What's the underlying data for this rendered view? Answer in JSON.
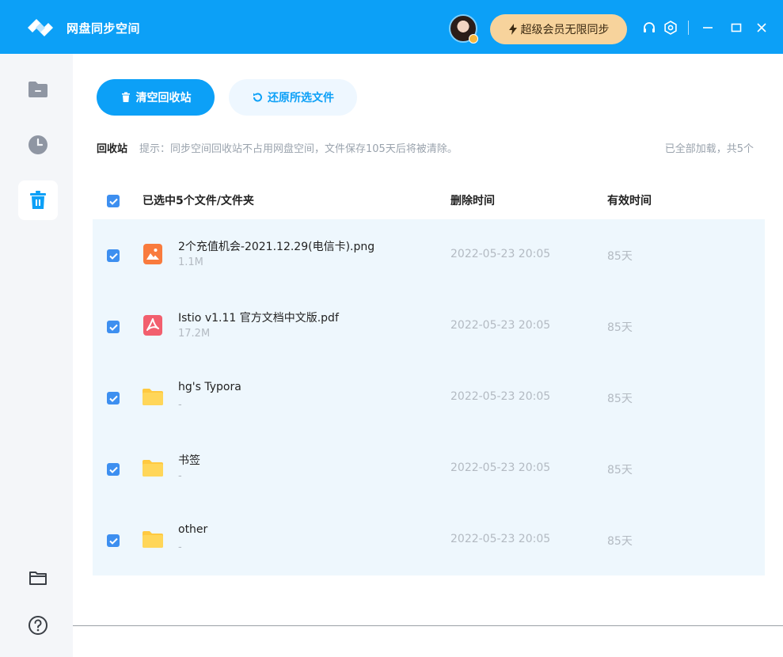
{
  "app": {
    "title": "网盘同步空间"
  },
  "header": {
    "vip_label": "超级会员无限同步",
    "icons": [
      "logo-icon",
      "headset-icon",
      "settings-icon",
      "minimize-icon",
      "maximize-icon",
      "close-icon"
    ]
  },
  "sidebar": {
    "items": [
      "folder-icon",
      "clock-icon",
      "trash-icon"
    ],
    "active": "trash-icon",
    "bottom": [
      "open-folder-icon",
      "help-icon"
    ]
  },
  "toolbar": {
    "empty_label": "清空回收站",
    "restore_label": "还原所选文件"
  },
  "info": {
    "crumb": "回收站",
    "tip": "提示：同步空间回收站不占用网盘空间，文件保存105天后将被清除。",
    "loaded": "已全部加载，共5个"
  },
  "table": {
    "headers": {
      "name": "已选中5个文件/文件夹",
      "deleted": "删除时间",
      "valid": "有效时间"
    },
    "rows": [
      {
        "name": "2个充值机会-2021.12.29(电信卡).png",
        "size": "1.1M",
        "deleted": "2022-05-23 20:05",
        "valid": "85天",
        "type": "image"
      },
      {
        "name": "Istio v1.11 官方文档中文版.pdf",
        "size": "17.2M",
        "deleted": "2022-05-23 20:05",
        "valid": "85天",
        "type": "pdf"
      },
      {
        "name": "hg's Typora",
        "size": "-",
        "deleted": "2022-05-23 20:05",
        "valid": "85天",
        "type": "folder"
      },
      {
        "name": "书签",
        "size": "-",
        "deleted": "2022-05-23 20:05",
        "valid": "85天",
        "type": "folder"
      },
      {
        "name": "other",
        "size": "-",
        "deleted": "2022-05-23 20:05",
        "valid": "85天",
        "type": "folder"
      }
    ]
  },
  "colors": {
    "brand": "#0ca0f7",
    "vip": "#f7d39c",
    "checkbox": "#3d8ff0",
    "table_bg": "#eef7fd"
  }
}
